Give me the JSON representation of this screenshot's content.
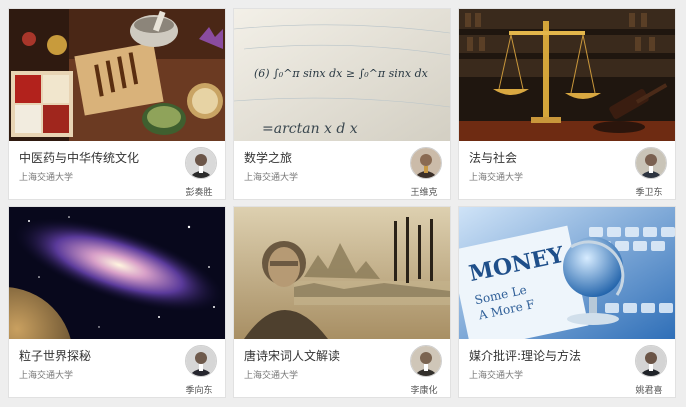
{
  "courses": [
    {
      "title": "中医药与中华传统文化",
      "school": "上海交通大学",
      "teacher": "彭奏胜",
      "image": "chinese-medicine-herbs-image",
      "accent": "#7a3b1c"
    },
    {
      "title": "数学之旅",
      "school": "上海交通大学",
      "teacher": "王维克",
      "image": "math-formula-paper-image",
      "accent": "#e6e2d6"
    },
    {
      "title": "法与社会",
      "school": "上海交通大学",
      "teacher": "季卫东",
      "image": "justice-scales-gavel-image",
      "accent": "#b8862a"
    },
    {
      "title": "粒子世界探秘",
      "school": "上海交通大学",
      "teacher": "季向东",
      "image": "galaxy-space-image",
      "accent": "#2a2a66"
    },
    {
      "title": "唐诗宋词人文解读",
      "school": "上海交通大学",
      "teacher": "李康化",
      "image": "landscape-poetry-portrait-image",
      "accent": "#c9b48a"
    },
    {
      "title": "媒介批评:理论与方法",
      "school": "上海交通大学",
      "teacher": "姚君喜",
      "image": "newspaper-globe-keyboard-image",
      "accent": "#3d7fc8"
    }
  ],
  "math_image_text": {
    "formula_line": "(6) ∫₀^π sinx dx ≥ ∫₀^π sinx dx",
    "bottom_line": "=arctan x d x"
  },
  "media_image_text": {
    "headline": "MONEY",
    "sub1": "Some Le",
    "sub2": "A More F"
  }
}
